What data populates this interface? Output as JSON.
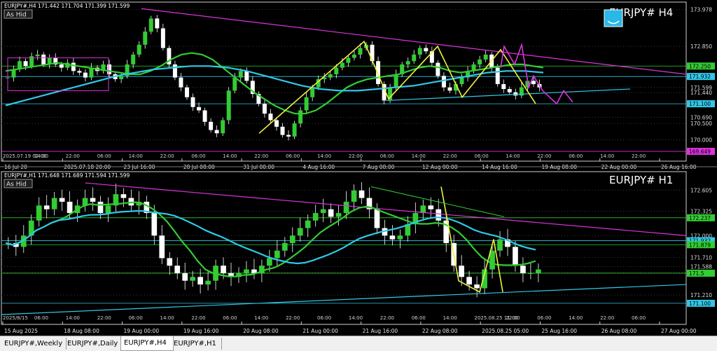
{
  "tabs": [
    "EURJPY#,Weekly",
    "EURJPY#,Daily",
    "EURJPY#,H4",
    "EURJPY#,H1"
  ],
  "active_tab": 2,
  "chart_data": [
    {
      "type": "candlestick",
      "symbol_header": "EURJPY#,H4  171.442 171.704 171.399 171.599",
      "big_label": "EURJPY# H4",
      "hide_button": "As Hid",
      "ylim": [
        169.65,
        174.2
      ],
      "yticks": [
        173.978,
        172.85,
        171.599,
        171.44,
        170.69,
        170.5,
        170.0
      ],
      "level_labels": [
        {
          "value": 172.25,
          "text": "172.250",
          "color": "#33cc33"
        },
        {
          "value": 171.932,
          "text": "171.932",
          "color": "#30c8e8"
        },
        {
          "value": 171.1,
          "text": "171.100",
          "color": "#30c8e8"
        },
        {
          "value": 169.649,
          "text": "169.649",
          "color": "#dd33dd"
        }
      ],
      "xticks": [
        "16 Jul 20",
        "2025.07.18 20:00",
        "23 Jul 16:00",
        "28 Jul 08:00",
        "31 Jul 00:00",
        "4 Aug 16:00",
        "7 Aug 08:00",
        "12 Aug 00:00",
        "14 Aug 16:00",
        "19 Aug 08:00",
        "22 Aug 00:00",
        "26 Aug 16:00"
      ],
      "hour_ticks": [
        "2025.07.19 02:00",
        "14:00",
        "22:00",
        "06:00",
        "14:00",
        "22:00",
        "06:00",
        "14:00",
        "22:00",
        "06:00",
        "14:00",
        "22:00",
        "06:00",
        "14:00",
        "22:00",
        "06:00",
        "14:00",
        "22:00",
        "06:00",
        "14:00",
        "22:00"
      ],
      "closes": [
        171.9,
        172.15,
        172.4,
        172.25,
        172.55,
        172.6,
        172.3,
        172.5,
        172.3,
        172.2,
        172.35,
        172.1,
        172.05,
        171.9,
        172.2,
        172.1,
        172.3,
        172.0,
        171.85,
        171.95,
        172.3,
        172.6,
        172.9,
        173.3,
        173.7,
        173.4,
        172.8,
        172.3,
        171.9,
        171.6,
        171.3,
        171.0,
        170.9,
        170.55,
        170.3,
        170.2,
        170.6,
        171.5,
        171.9,
        172.1,
        171.8,
        171.4,
        171.1,
        170.8,
        170.6,
        170.4,
        170.15,
        170.1,
        170.5,
        170.9,
        171.3,
        171.6,
        171.85,
        171.9,
        172.0,
        172.2,
        172.35,
        172.5,
        172.6,
        172.8,
        172.9,
        172.4,
        171.7,
        171.2,
        171.6,
        172.0,
        172.3,
        172.4,
        172.6,
        172.8,
        172.7,
        172.35,
        171.95,
        171.6,
        171.5,
        171.7,
        171.9,
        172.1,
        172.3,
        172.45,
        172.6,
        172.2,
        171.7,
        171.55,
        171.45,
        171.35,
        171.6,
        171.8,
        171.7,
        171.6
      ],
      "moving_averages": [
        {
          "name": "",
          "color": "#33cc33",
          "values": [
            172.1,
            172.15,
            172.2,
            172.25,
            172.3,
            172.35,
            172.3,
            172.25,
            172.2,
            172.15,
            172.1,
            172.05,
            172.0,
            172.0,
            172.1,
            172.25,
            172.45,
            172.6,
            172.65,
            172.6,
            172.45,
            172.2,
            171.95,
            171.7,
            171.45,
            171.25,
            171.05,
            170.9,
            170.8,
            170.8,
            170.9,
            171.1,
            171.35,
            171.6,
            171.75,
            171.85,
            171.9,
            171.95,
            172.0,
            172.1,
            172.2,
            172.25,
            172.2,
            172.1,
            172.05,
            172.1,
            172.15,
            172.2,
            172.25,
            172.3,
            172.3,
            172.25,
            172.2
          ]
        },
        {
          "name": "",
          "color": "#30c8e8",
          "values": [
            171.05,
            171.2,
            171.35,
            171.5,
            171.65,
            171.8,
            171.95,
            172.05,
            172.15,
            172.2,
            172.25,
            172.25,
            172.2,
            172.1,
            171.95,
            171.8,
            171.65,
            171.55,
            171.5,
            171.5,
            171.55,
            171.6,
            171.65,
            171.75,
            171.85,
            171.95,
            172.05,
            172.1,
            172.1,
            172.05
          ]
        }
      ],
      "zigzag": [
        [
          173.0,
          172.85
        ],
        [
          171.25,
          171.45
        ],
        [
          172.85,
          172.6
        ],
        [
          171.3,
          171.5
        ],
        [
          172.75,
          172.75
        ],
        [
          171.1,
          171.3
        ]
      ],
      "annotations": []
    },
    {
      "type": "candlestick",
      "symbol_header": "EURJPY#,H1  171.648 171.689 171.594 171.599",
      "big_label": "EURJPY# H1",
      "hide_button": "As Hid",
      "ylim": [
        170.95,
        172.85
      ],
      "yticks": [
        172.605,
        172.325,
        172.0,
        171.71,
        171.588,
        171.509,
        171.21
      ],
      "level_labels": [
        {
          "value": 172.237,
          "text": "172.237",
          "color": "#33cc33"
        },
        {
          "value": 171.932,
          "text": "171.932",
          "color": "#30c8e8"
        },
        {
          "value": 171.879,
          "text": "171.879",
          "color": "#33cc33"
        },
        {
          "value": 171.5,
          "text": "171.5",
          "color": "#33cc33"
        },
        {
          "value": 171.1,
          "text": "171.100",
          "color": "#30c8e8"
        }
      ],
      "xticks": [
        "15 Aug 2025",
        "18 Aug 08:00",
        "19 Aug 00:00",
        "19 Aug 16:00",
        "20 Aug 08:00",
        "21 Aug 00:00",
        "21 Aug 16:00",
        "22 Aug 08:00",
        "2025.08.25 05:00",
        "25 Aug 16:00",
        "26 Aug 08:00",
        "27 Aug 00:00"
      ],
      "hour_ticks": [
        "2025/8/15",
        "06:00",
        "14:00",
        "22:00",
        "06:00",
        "14:00",
        "22:00",
        "06:00",
        "14:00",
        "22:00",
        "06:00",
        "14:00",
        "22:00",
        "06:00",
        "14:00",
        "2025.08.25 11:00",
        "22:00",
        "06:00",
        "14:00",
        "22:00",
        "06:00"
      ],
      "closes": [
        171.9,
        171.85,
        172.0,
        172.2,
        172.4,
        172.35,
        172.5,
        172.45,
        172.3,
        172.4,
        172.5,
        172.45,
        172.3,
        172.4,
        172.55,
        172.5,
        172.4,
        172.45,
        172.3,
        172.0,
        171.7,
        171.6,
        171.5,
        171.4,
        171.45,
        171.35,
        171.4,
        171.6,
        171.5,
        171.45,
        171.5,
        171.55,
        171.5,
        171.6,
        171.7,
        171.8,
        171.9,
        172.0,
        172.1,
        172.2,
        172.3,
        172.35,
        172.25,
        172.3,
        172.45,
        172.6,
        172.5,
        172.35,
        172.1,
        172.0,
        171.95,
        172.0,
        172.15,
        172.3,
        172.4,
        172.35,
        172.2,
        171.9,
        171.6,
        171.45,
        171.35,
        171.3,
        171.55,
        171.8,
        171.95,
        171.85,
        171.6,
        171.5,
        171.5,
        171.55
      ]
    }
  ]
}
